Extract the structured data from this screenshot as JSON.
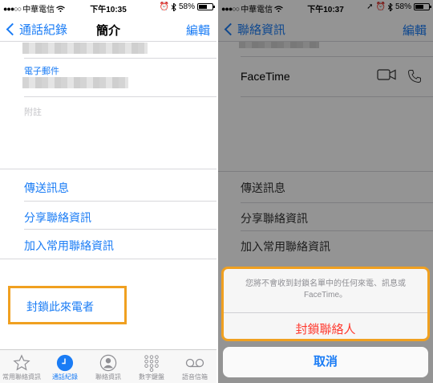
{
  "left": {
    "status": {
      "carrier": "中華電信",
      "time": "下午10:35",
      "battery": "58%"
    },
    "nav": {
      "back": "通話紀錄",
      "title": "簡介",
      "edit": "編輯"
    },
    "email_label": "電子郵件",
    "notes_label": "附註",
    "actions": [
      "傳送訊息",
      "分享聯絡資訊",
      "加入常用聯絡資訊"
    ],
    "block_caller": "封鎖此來電者",
    "tabs": [
      {
        "label": "常用聯絡資訊",
        "icon": "star-icon",
        "active": false
      },
      {
        "label": "通話紀錄",
        "icon": "clock-icon",
        "active": true
      },
      {
        "label": "聯絡資訊",
        "icon": "person-icon",
        "active": false
      },
      {
        "label": "數字鍵盤",
        "icon": "keypad-icon",
        "active": false
      },
      {
        "label": "語音信箱",
        "icon": "voicemail-icon",
        "active": false
      }
    ]
  },
  "right": {
    "status": {
      "carrier": "中華電信",
      "time": "下午10:37",
      "battery": "58%"
    },
    "nav": {
      "back": "聯絡資訊",
      "edit": "編輯"
    },
    "facetime_label": "FaceTime",
    "actions": [
      "傳送訊息",
      "分享聯絡資訊",
      "加入常用聯絡資訊"
    ],
    "sheet": {
      "message": "您將不會收到封鎖名單中的任何來電、訊息或 FaceTime。",
      "block_contact": "封鎖聯絡人",
      "cancel": "取消"
    }
  },
  "colors": {
    "accent": "#1a7cf5",
    "destructive": "#ff3b30",
    "highlight": "#f0a020"
  }
}
